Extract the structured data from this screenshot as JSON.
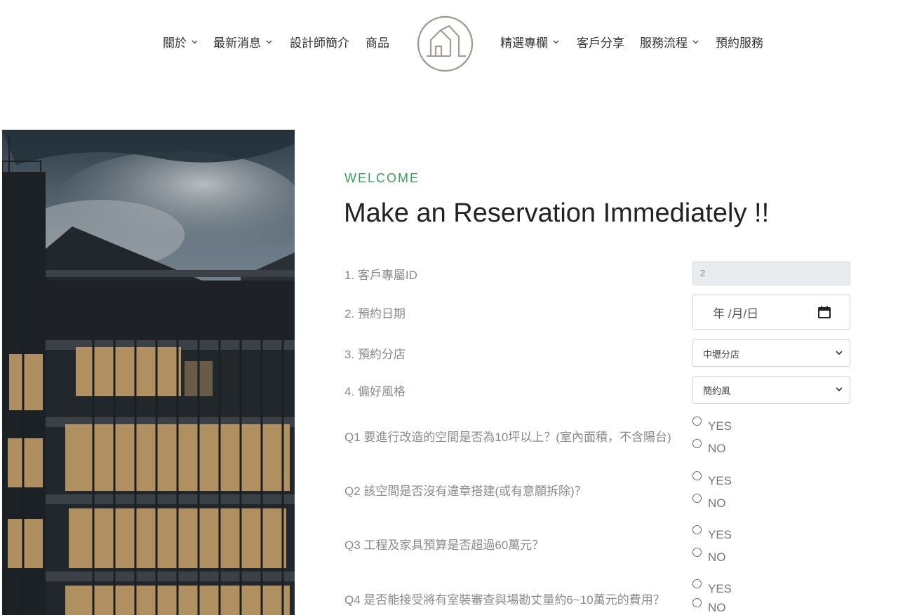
{
  "nav": {
    "items": [
      {
        "label": "關於",
        "has_dropdown": true
      },
      {
        "label": "最新消息",
        "has_dropdown": true
      },
      {
        "label": "設計師簡介",
        "has_dropdown": false
      },
      {
        "label": "商品",
        "has_dropdown": false
      },
      {
        "label": "精選專欄",
        "has_dropdown": true
      },
      {
        "label": "客戶分享",
        "has_dropdown": false
      },
      {
        "label": "服務流程",
        "has_dropdown": true
      },
      {
        "label": "預約服務",
        "has_dropdown": false
      }
    ],
    "logo_icon": "house-logo-icon"
  },
  "form": {
    "eyebrow": "WELCOME",
    "title": "Make an Reservation Immediately !!",
    "fields": {
      "customer_id": {
        "label": "1. 客戶專屬ID",
        "value": "2"
      },
      "date": {
        "label": "2. 預約日期",
        "placeholder": "年 /月/日"
      },
      "branch": {
        "label": "3. 預約分店",
        "selected": "中壢分店"
      },
      "style": {
        "label": "4. 偏好風格",
        "selected": "簡約風"
      }
    },
    "questions": [
      {
        "text": "Q1 要進行改造的空間是否為10坪以上？(室內面積，不含陽台)",
        "yes": "YES",
        "no": "NO"
      },
      {
        "text": "Q2 該空間是否沒有違章搭建(或有意願拆除)？",
        "yes": "YES",
        "no": "NO"
      },
      {
        "text": "Q3 工程及家具預算是否超過60萬元？",
        "yes": "YES",
        "no": "NO"
      },
      {
        "text": "Q4 是否能接受將有室裝審查與場勘丈量約6~10萬元的費用？",
        "yes": "YES",
        "no": "NO"
      }
    ]
  },
  "colors": {
    "accent": "#3a9d5d",
    "logo": "#a39c93"
  }
}
